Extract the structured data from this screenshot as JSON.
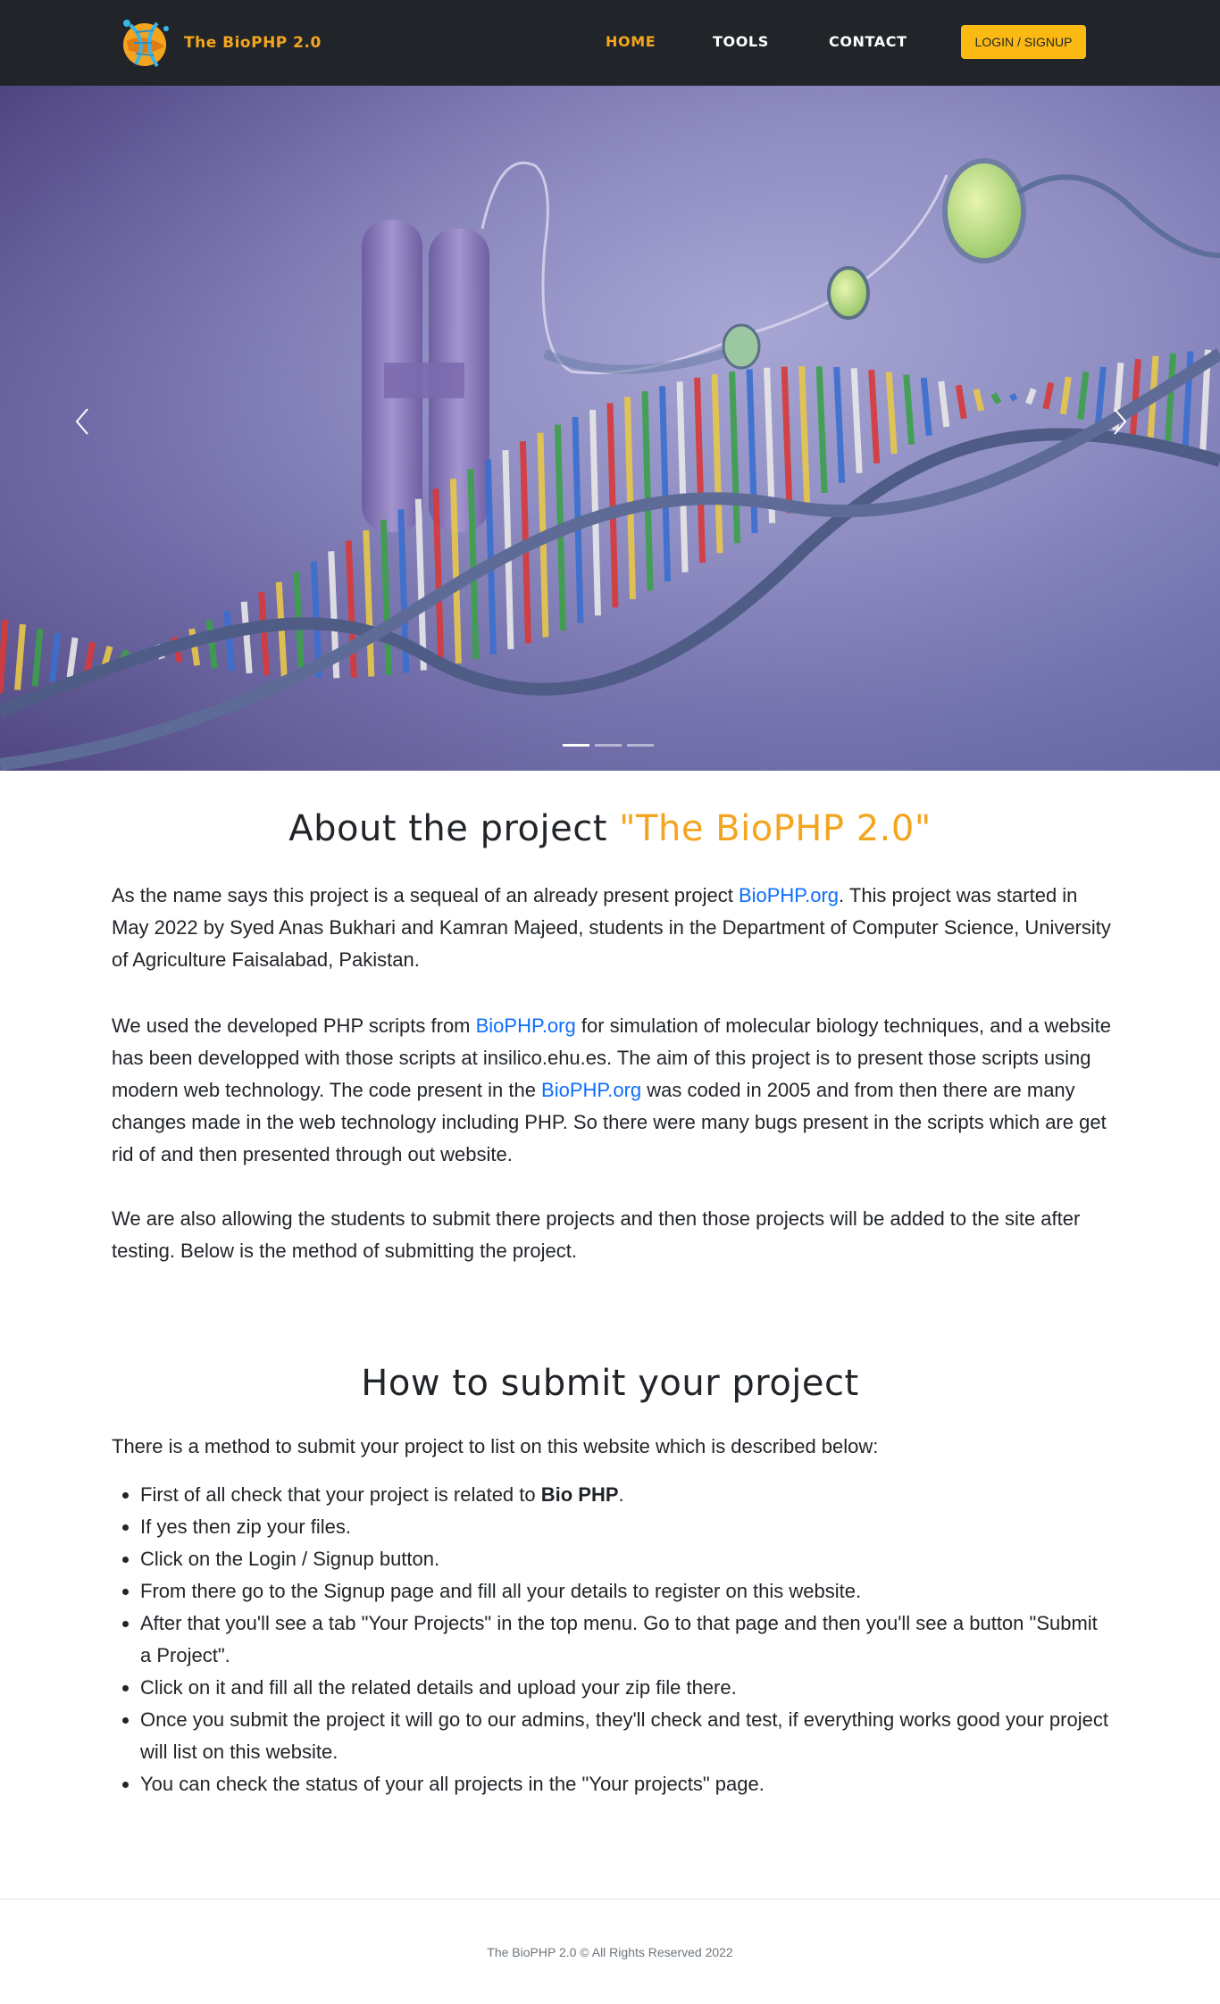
{
  "navbar": {
    "brand": "The BioPHP 2.0",
    "logo_icon": "dna-globe-logo-icon",
    "links": [
      {
        "label": "HOME",
        "active": true
      },
      {
        "label": "TOOLS",
        "active": false
      },
      {
        "label": "CONTACT",
        "active": false
      }
    ],
    "login_label": "LOGIN / SIGNUP",
    "accent_color": "#f4a51f",
    "button_color": "#fdb913",
    "background": "#212529"
  },
  "carousel": {
    "prev_icon": "chevron-left-icon",
    "next_icon": "chevron-right-icon",
    "slide_count": 3,
    "active_slide": 1
  },
  "about": {
    "title_prefix": "About the project ",
    "title_accent": "\"The BioPHP 2.0\"",
    "p1_a": "As the name says this project is a sequeal of an already present project ",
    "p1_link": "BioPHP.org",
    "p1_b": ". This project was started in May 2022 by Syed Anas Bukhari and Kamran Majeed, students in the Department of Computer Science, University of Agriculture Faisalabad, Pakistan.",
    "p2_a": "We used the developed PHP scripts from ",
    "p2_link1": "BioPHP.org",
    "p2_b": " for simulation of molecular biology techniques, and a website has been developped with those scripts at insilico.ehu.es. The aim of this project is to present those scripts using modern web technology. The code present in the ",
    "p2_link2": "BioPHP.org",
    "p2_c": " was coded in 2005 and from then there are many changes made in the web technology including PHP. So there were many bugs present in the scripts which are get rid of and then presented through out website.",
    "p3": "We are also allowing the students to submit there projects and then those projects will be added to the site after testing. Below is the method of submitting the project."
  },
  "howto": {
    "title": "How to submit your project",
    "intro": "There is a method to submit your project to list on this website which is described below:",
    "step1_a": "First of all check that your project is related to ",
    "step1_bold": "Bio PHP",
    "step1_b": ".",
    "steps": [
      "If yes then zip your files.",
      "Click on the Login / Signup button.",
      "From there go to the Signup page and fill all your details to register on this website.",
      "After that you'll see a tab \"Your Projects\" in the top menu. Go to that page and then you'll see a button \"Submit a Project\".",
      "Click on it and fill all the related details and upload your zip file there.",
      "Once you submit the project it will go to our admins, they'll check and test, if everything works good your project will list on this website.",
      "You can check the status of your all projects in the \"Your projects\" page."
    ]
  },
  "footer": {
    "text": "The BioPHP 2.0 © All Rights Reserved 2022"
  }
}
